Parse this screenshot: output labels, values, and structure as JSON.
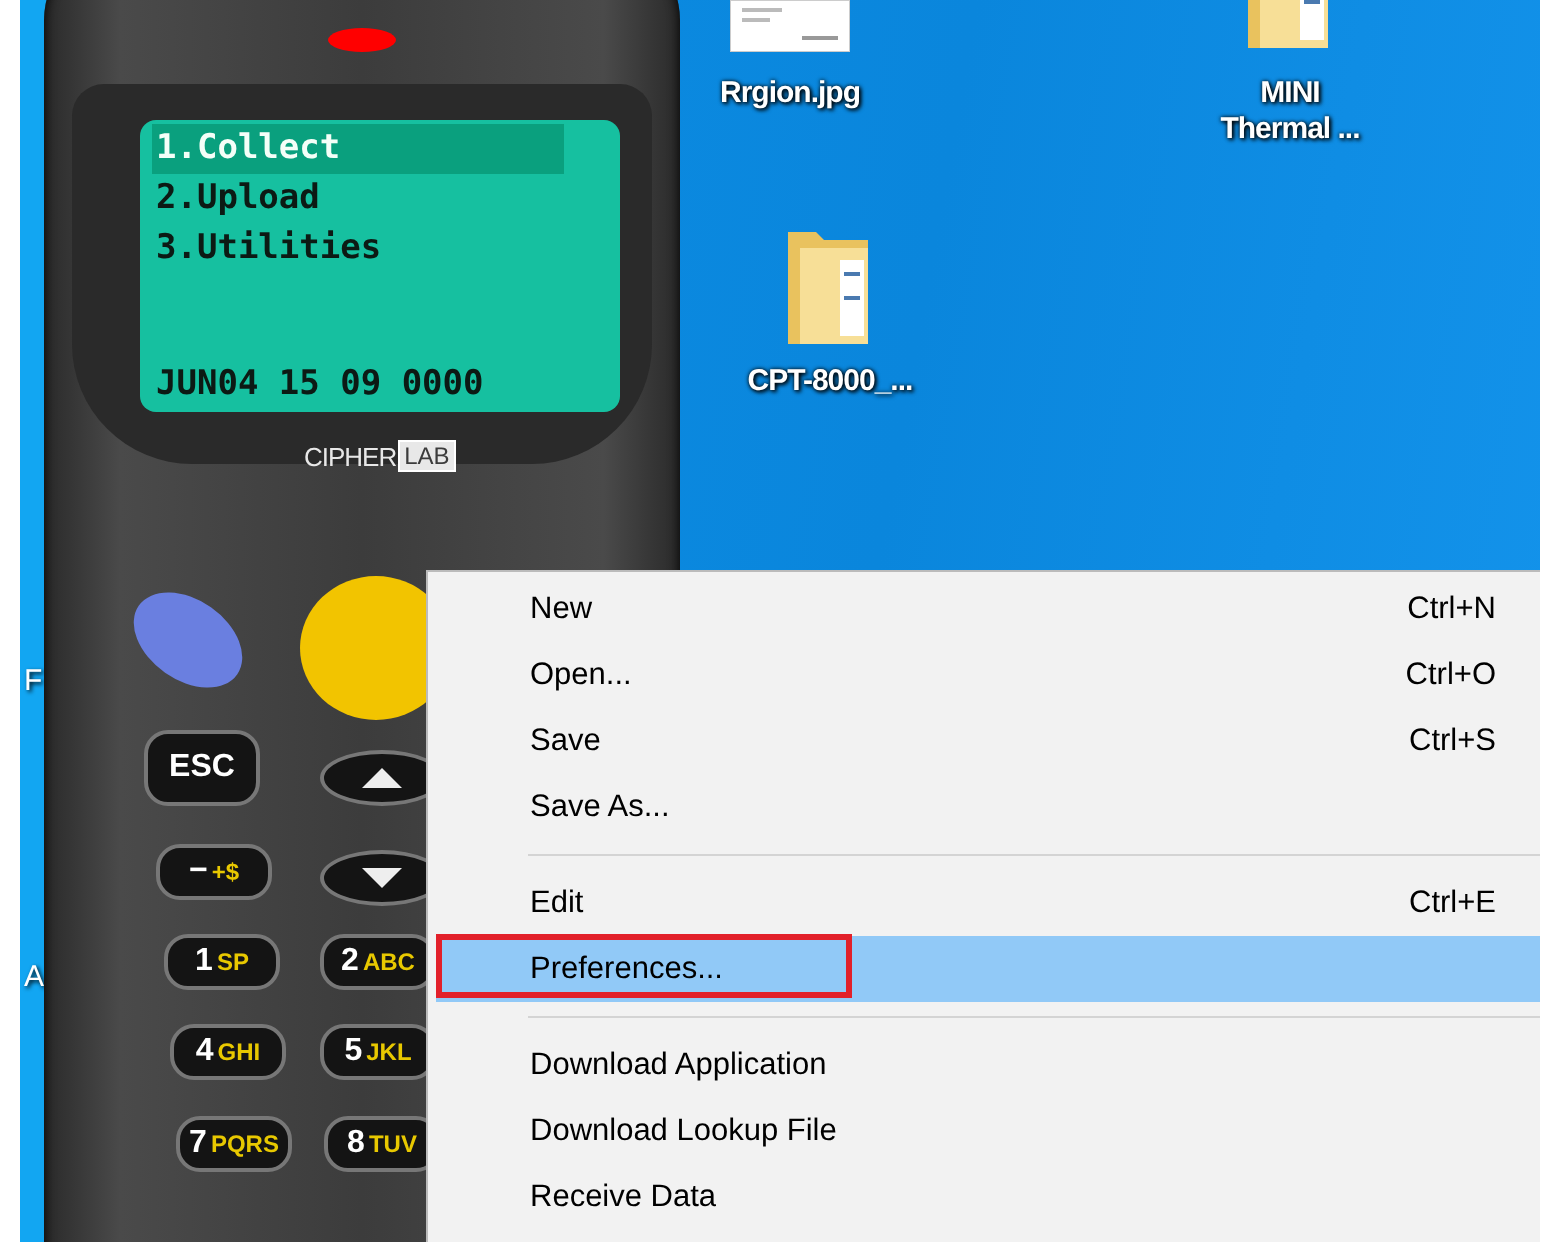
{
  "desktop": {
    "icons": [
      {
        "kind": "image",
        "label_lines": [
          "Rrgion.jpg"
        ]
      },
      {
        "kind": "folder",
        "label_lines": [
          "MINI",
          "Thermal ..."
        ]
      },
      {
        "kind": "folder",
        "label_lines": [
          "CPT-8000_..."
        ]
      }
    ],
    "hidden_labels": [
      "F",
      "A"
    ]
  },
  "device": {
    "screen": {
      "lines": [
        {
          "text": "1.Collect",
          "selected": true
        },
        {
          "text": "2.Upload",
          "selected": false
        },
        {
          "text": "3.Utilities",
          "selected": false
        }
      ],
      "status": "JUN04 15 09 0000"
    },
    "logo": {
      "text": "CIPHER",
      "boxed": "LAB"
    },
    "keys": [
      {
        "kind": "text",
        "main": "ESC"
      },
      {
        "kind": "arrow_up"
      },
      {
        "kind": "text",
        "main": "−",
        "sub": "+$"
      },
      {
        "kind": "arrow_down"
      },
      {
        "kind": "text",
        "main": "1",
        "sub": "SP"
      },
      {
        "kind": "text",
        "main": "2",
        "sub": "ABC"
      },
      {
        "kind": "text",
        "main": "4",
        "sub": "GHI"
      },
      {
        "kind": "text",
        "main": "5",
        "sub": "JKL"
      },
      {
        "kind": "text",
        "main": "7",
        "sub": "PQRS"
      },
      {
        "kind": "text",
        "main": "8",
        "sub": "TUV"
      }
    ]
  },
  "context_menu": {
    "groups": [
      [
        {
          "label": "New",
          "shortcut": "Ctrl+N",
          "selected": false,
          "outlined": false
        },
        {
          "label": "Open...",
          "shortcut": "Ctrl+O",
          "selected": false,
          "outlined": false
        },
        {
          "label": "Save",
          "shortcut": "Ctrl+S",
          "selected": false,
          "outlined": false
        },
        {
          "label": "Save As...",
          "selected": false,
          "outlined": false
        }
      ],
      [
        {
          "label": "Edit",
          "shortcut": "Ctrl+E",
          "selected": false,
          "outlined": false
        },
        {
          "label": "Preferences...",
          "selected": true,
          "outlined": true
        }
      ],
      [
        {
          "label": "Download Application",
          "selected": false,
          "outlined": false
        },
        {
          "label": "Download Lookup File",
          "selected": false,
          "outlined": false
        },
        {
          "label": "Receive Data",
          "selected": false,
          "outlined": false
        }
      ]
    ]
  }
}
